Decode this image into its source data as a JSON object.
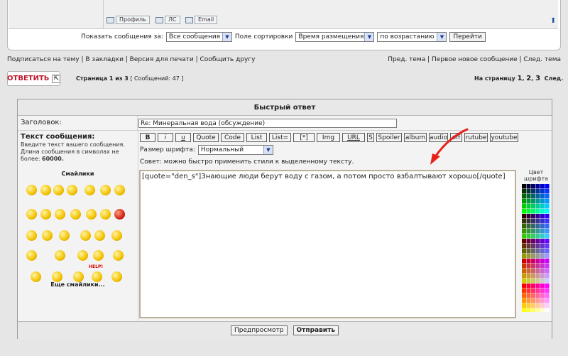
{
  "post_buttons": {
    "profile": "Профиль",
    "pm": "ЛС",
    "email": "Email"
  },
  "sortbar": {
    "show_label": "Показать сообщения за:",
    "show_value": "Все сообщения",
    "sort_label": "Поле сортировки",
    "sort_value": "Время размещения",
    "order_value": "по возрастанию",
    "go_button": "Перейти"
  },
  "links": {
    "left": "Подписаться на тему | В закладки | Версия для печати | Сообщить другу",
    "right": "Пред. тема | Первое новое сообщение | След. тема"
  },
  "reply_button": "ОТВЕТИТЬ",
  "page_info": {
    "page": "Страница 1 из 3",
    "count": "[ Сообщений: 47 ]"
  },
  "page_nav": {
    "label": "На страницу",
    "p1": "1",
    "p2": "2",
    "p3": "3",
    "sep": ",",
    "next": "След."
  },
  "quick_reply": {
    "title": "Быстрый ответ",
    "subject_label": "Заголовок:",
    "subject_value": "Re: Минеральная вода (обсуждение)",
    "message_label": "Текст сообщения:",
    "message_hint": "Введите текст вашего сообщения. Длина сообщения в символах не более:",
    "max_len": "60000.",
    "smilies_label": "Смайлики",
    "more_smilies": "Еще смайлики...",
    "bbcode": [
      "B",
      "i",
      "u",
      "Quote",
      "Code",
      "List",
      "List=",
      "[*]",
      "Img",
      "URL",
      "S",
      "Spoiler",
      "album",
      "audio",
      "off",
      "rutube",
      "youtube"
    ],
    "font_size_label": "Размер шрифта:",
    "font_size_value": "Нормальный",
    "tip": "Совет: можно быстро применить стили к выделенному тексту.",
    "message_text": "[quote=\"den_s\"]Знающие люди берут воду с газом, а потом просто взбалтывают хорошо[/quote]",
    "color_label": "Цвет шрифта",
    "help_text": "HELP!",
    "preview_button": "Предпросмотр",
    "submit_button": "Отправить"
  },
  "colors": {
    "reply_red": "#c0162d",
    "annotation": "#e8201a",
    "link_blue": "#1a4f9c"
  }
}
